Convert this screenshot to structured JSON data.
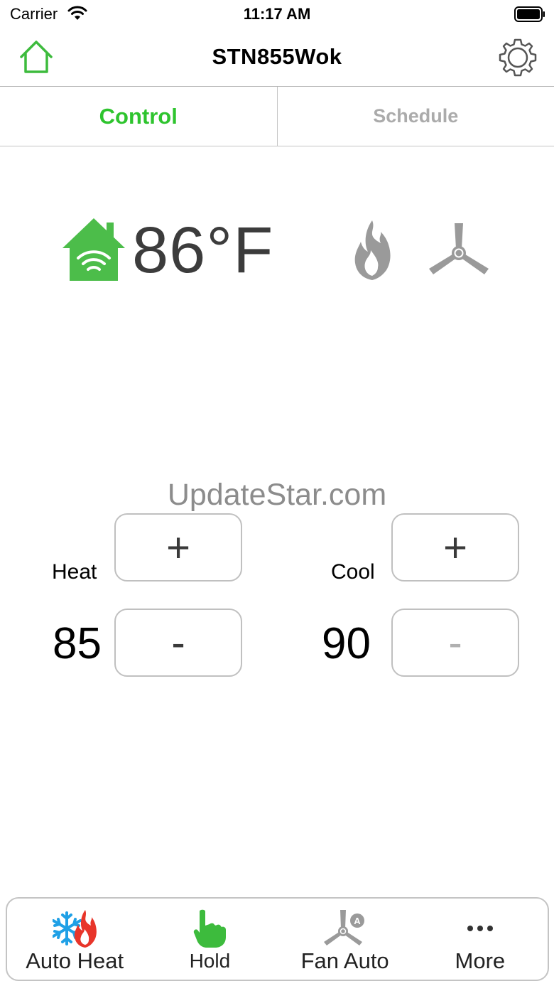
{
  "status_bar": {
    "carrier": "Carrier",
    "time": "11:17 AM"
  },
  "nav": {
    "title": "STN855Wok",
    "home_icon": "home-outline-icon",
    "settings_icon": "gear-icon"
  },
  "tabs": [
    {
      "label": "Control",
      "active": true
    },
    {
      "label": "Schedule",
      "active": false
    }
  ],
  "current": {
    "temperature": "86°F",
    "status_icons": [
      "house-wifi-icon",
      "flame-icon",
      "fan-icon"
    ]
  },
  "watermark": "UpdateStar.com",
  "setpoints": {
    "heat": {
      "label": "Heat",
      "value": "85",
      "plus": "+",
      "minus": "-"
    },
    "cool": {
      "label": "Cool",
      "value": "90",
      "plus": "+",
      "minus": "-"
    }
  },
  "toolbar": {
    "items": [
      {
        "label": "Auto Heat",
        "icon": "snowflake-flame-icon"
      },
      {
        "label": "Hold",
        "icon": "hand-pointer-icon"
      },
      {
        "label": "Fan Auto",
        "icon": "fan-auto-icon"
      },
      {
        "label": "More",
        "icon": "more-dots-icon"
      }
    ]
  },
  "colors": {
    "accent_green": "#2ec42e",
    "icon_gray": "#9a9a9a",
    "snowflake_blue": "#1fa0e6",
    "flame_red": "#e8352a"
  }
}
